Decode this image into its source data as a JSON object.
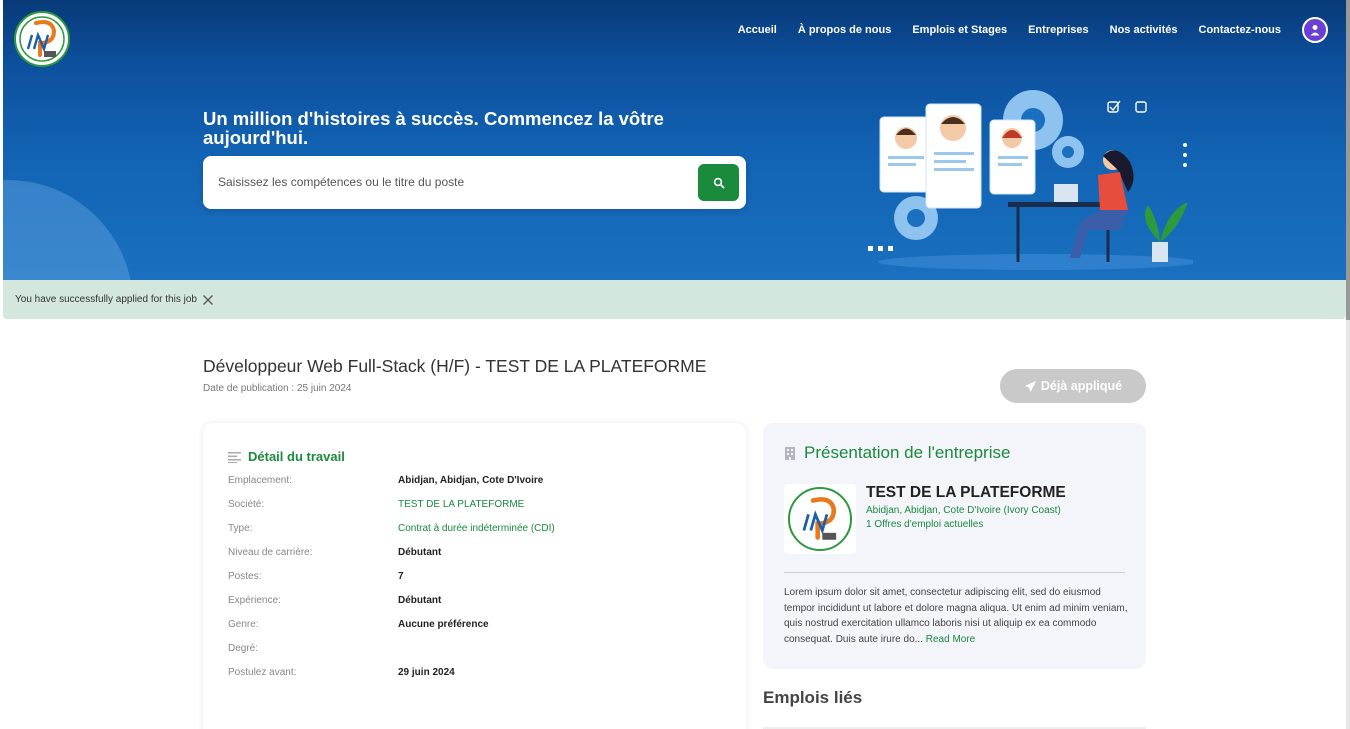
{
  "nav": {
    "items": [
      "Accueil",
      "À propos de nous",
      "Emplois et Stages",
      "Entreprises",
      "Nos activités",
      "Contactez-nous"
    ]
  },
  "hero": {
    "title": "Un million d'histoires à succès. Commencez la vôtre aujourd'hui.",
    "search_placeholder": "Saisissez les compétences ou le titre du poste"
  },
  "alert": {
    "message": "You have successfully applied for this job"
  },
  "job": {
    "title": "Développeur Web Full-Stack (H/F) - TEST DE LA PLATEFORME",
    "date": "Date de publication : 25 juin 2024",
    "applied_label": "Déjà appliqué"
  },
  "detail": {
    "heading": "Détail du travail",
    "rows": [
      {
        "label": "Emplacement:",
        "value": "Abidjan, Abidjan, Cote D'Ivoire"
      },
      {
        "label": "Société:",
        "value": "TEST DE LA PLATEFORME"
      },
      {
        "label": "Type:",
        "value": "Contrat à durée indéterminée (CDI)"
      },
      {
        "label": "Niveau de carrière:",
        "value": "Débutant"
      },
      {
        "label": "Postes:",
        "value": "7"
      },
      {
        "label": "Expérience:",
        "value": "Débutant"
      },
      {
        "label": "Genre:",
        "value": "Aucune préférence"
      },
      {
        "label": "Degré:",
        "value": ""
      },
      {
        "label": "Postulez avant:",
        "value": "29 juin 2024"
      }
    ]
  },
  "company": {
    "heading": "Présentation de l'entreprise",
    "name": "TEST DE LA PLATEFORME",
    "location": "Abidjan, Abidjan, Cote D'Ivoire (Ivory Coast)",
    "offers": "1 Offres d'emploi actuelles",
    "description": "Lorem ipsum dolor sit amet, consectetur adipiscing elit, sed do eiusmod tempor incididunt ut labore et dolore magna aliqua. Ut enim ad minim veniam, quis nostrud exercitation ullamco laboris nisi ut aliquip ex ea commodo consequat. Duis aute irure do...",
    "read_more": "Read More"
  },
  "related": {
    "heading": "Emplois liés"
  },
  "colors": {
    "brand_blue": "#1263b4",
    "accent_green": "#1a8a3c",
    "alert_bg": "#d4e7dd"
  }
}
